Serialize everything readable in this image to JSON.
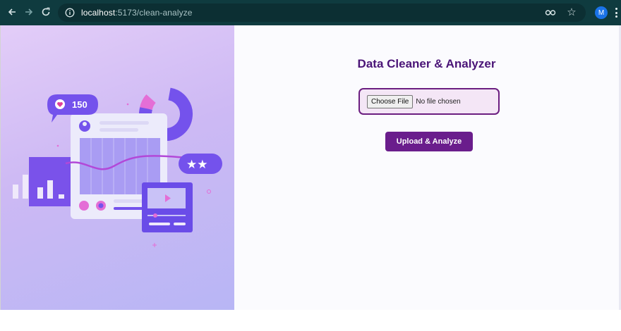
{
  "browser": {
    "url_host": "localhost",
    "url_path": ":5173/clean-analyze",
    "profile_initial": "M"
  },
  "main": {
    "title": "Data Cleaner & Analyzer",
    "choose_file_label": "Choose File",
    "file_status": "No file chosen",
    "upload_button": "Upload & Analyze"
  },
  "illustration": {
    "likes_count": "150",
    "rating_stars": "★★"
  },
  "colors": {
    "accent": "#6a1d8c",
    "title": "#4a1477",
    "chrome": "#0f3b3f"
  }
}
